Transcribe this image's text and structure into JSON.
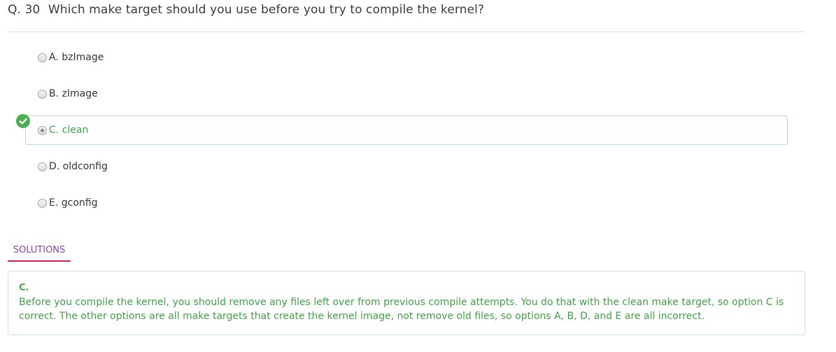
{
  "question": {
    "number": "Q. 30",
    "text": "Which make target should you use before you try to compile the kernel?"
  },
  "options": [
    {
      "label": "A. bzImage"
    },
    {
      "label": "B. zImage"
    },
    {
      "label": "C. clean"
    },
    {
      "label": "D. oldconfig"
    },
    {
      "label": "E. gconfig"
    }
  ],
  "selected_option": "C. clean",
  "correct_option": "C. clean",
  "solutions": {
    "tab_label": "SOLUTIONS",
    "answer": "C.",
    "explanation": "Before you compile the kernel, you should remove any files left over from previous compile attempts. You do that with the clean make target, so option C is correct. The other options are all make targets that create the kernel image, not remove old files, so options A, B, D, and E are all incorrect."
  },
  "icons": {
    "correct_marker": "check-circle-icon"
  },
  "colors": {
    "correct_green": "#43a047",
    "tab_text": "#8e44ad",
    "tab_underline": "#d81b60"
  }
}
